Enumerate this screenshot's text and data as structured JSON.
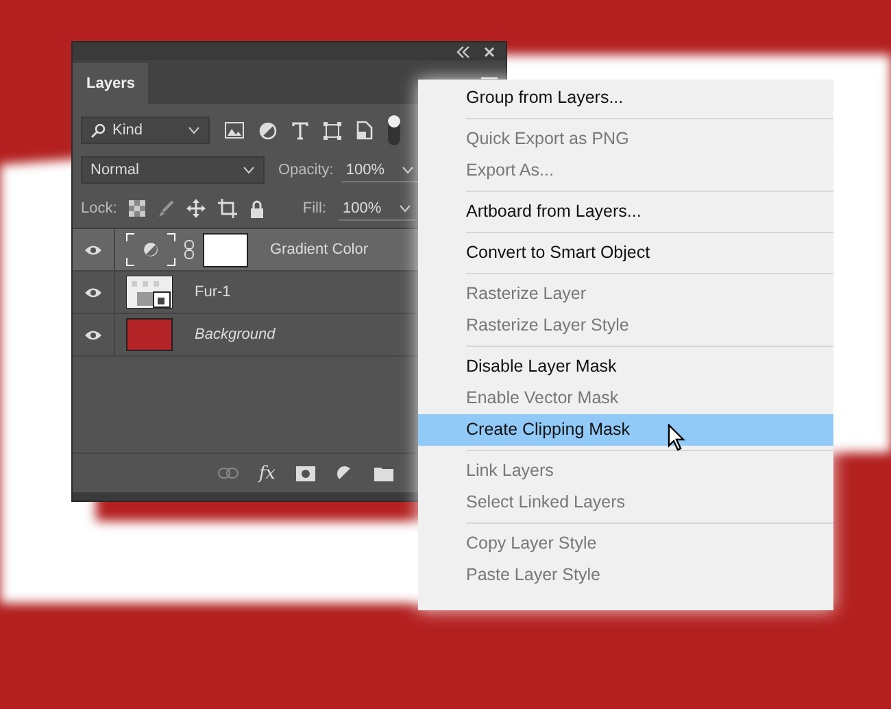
{
  "panel": {
    "tab": {
      "label": "Layers",
      "selected": true
    },
    "filter": {
      "value": "Kind"
    },
    "blend_mode": {
      "value": "Normal"
    },
    "opacity": {
      "label": "Opacity:",
      "value": "100%"
    },
    "lock": {
      "label": "Lock:"
    },
    "fill": {
      "label": "Fill:",
      "value": "100%"
    },
    "layers": [
      {
        "name": "Gradient Color",
        "kind": "adjustment",
        "selected": true
      },
      {
        "name": "Fur-1",
        "kind": "smart",
        "selected": false
      },
      {
        "name": "Background",
        "kind": "background",
        "selected": false
      }
    ],
    "footer": {
      "effects_label": "fx"
    }
  },
  "menu": {
    "groups": [
      [
        {
          "label": "Group from Layers...",
          "disabled": false,
          "selected": false
        }
      ],
      [
        {
          "label": "Quick Export as PNG",
          "disabled": true,
          "selected": false
        },
        {
          "label": "Export As...",
          "disabled": true,
          "selected": false
        }
      ],
      [
        {
          "label": "Artboard from Layers...",
          "disabled": false,
          "selected": false
        }
      ],
      [
        {
          "label": "Convert to Smart Object",
          "disabled": false,
          "selected": false
        }
      ],
      [
        {
          "label": "Rasterize Layer",
          "disabled": true,
          "selected": false
        },
        {
          "label": "Rasterize Layer Style",
          "disabled": true,
          "selected": false
        }
      ],
      [
        {
          "label": "Disable Layer Mask",
          "disabled": false,
          "selected": false
        },
        {
          "label": "Enable Vector Mask",
          "disabled": true,
          "selected": false
        },
        {
          "label": "Create Clipping Mask",
          "disabled": false,
          "selected": true
        }
      ],
      [
        {
          "label": "Link Layers",
          "disabled": true,
          "selected": false
        },
        {
          "label": "Select Linked Layers",
          "disabled": true,
          "selected": false
        }
      ],
      [
        {
          "label": "Copy Layer Style",
          "disabled": true,
          "selected": false
        },
        {
          "label": "Paste Layer Style",
          "disabled": true,
          "selected": false
        }
      ]
    ]
  }
}
